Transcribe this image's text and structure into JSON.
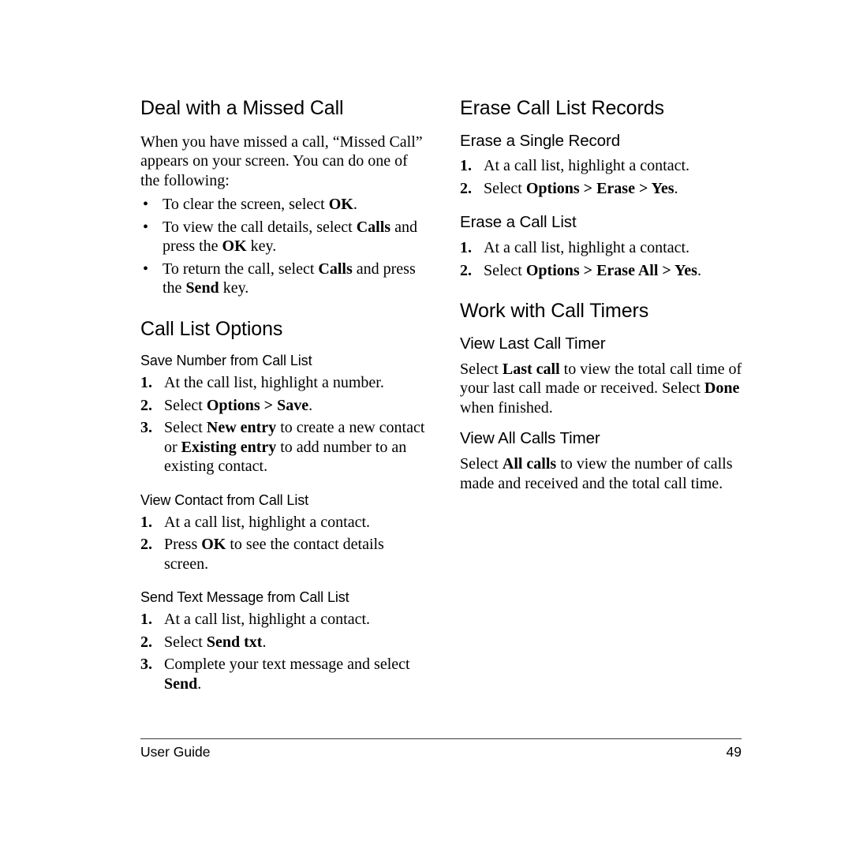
{
  "page": {
    "footer_label": "User Guide",
    "page_number": "49"
  },
  "left_column": {
    "section1": {
      "heading": "Deal with a Missed Call",
      "intro": "When you have missed a call, “Missed Call” appears on your screen. You can do one of the following:",
      "bullets": [
        {
          "marker": "•",
          "text_before": "To clear the screen, select ",
          "bold1": "OK",
          "text_after": "."
        },
        {
          "marker": "•",
          "text_before": "To view the call details, select ",
          "bold1": "Calls",
          "text_mid": " and press the ",
          "bold2": "OK",
          "text_after": " key."
        },
        {
          "marker": "•",
          "text_before": "To return the call, select ",
          "bold1": "Calls",
          "text_mid": " and press the ",
          "bold2": "Send",
          "text_after": " key."
        }
      ]
    },
    "section2": {
      "heading": "Call List Options",
      "sub1": {
        "heading": "Save Number from Call List",
        "steps": [
          {
            "marker": "1.",
            "text_before": "At the call list, highlight a number.",
            "bold1": "",
            "text_after": ""
          },
          {
            "marker": "2.",
            "text_before": "Select ",
            "bold1": "Options > Save",
            "text_after": "."
          },
          {
            "marker": "3.",
            "text_before": "Select ",
            "bold1": "New entry",
            "text_mid": " to create a new contact or ",
            "bold2": "Existing entry",
            "text_after": " to add number to an existing contact."
          }
        ]
      },
      "sub2": {
        "heading": "View Contact from Call List",
        "steps": [
          {
            "marker": "1.",
            "text_before": "At a call list, highlight a contact.",
            "bold1": "",
            "text_after": ""
          },
          {
            "marker": "2.",
            "text_before": "Press ",
            "bold1": "OK",
            "text_after": " to see the contact details screen."
          }
        ]
      },
      "sub3": {
        "heading": "Send Text Message from Call List",
        "steps": [
          {
            "marker": "1.",
            "text_before": "At a call list, highlight a contact.",
            "bold1": "",
            "text_after": ""
          },
          {
            "marker": "2.",
            "text_before": "Select ",
            "bold1": "Send txt",
            "text_after": "."
          },
          {
            "marker": "3.",
            "text_before": "Complete your text message and select ",
            "bold1": "Send",
            "text_after": "."
          }
        ]
      }
    }
  },
  "right_column": {
    "section1": {
      "heading": "Erase Call List Records",
      "sub1": {
        "heading": "Erase a Single Record",
        "steps": [
          {
            "marker": "1.",
            "text_before": "At a call list, highlight a contact.",
            "bold1": "",
            "text_after": ""
          },
          {
            "marker": "2.",
            "text_before": "Select ",
            "bold1": "Options > Erase > Yes",
            "text_after": "."
          }
        ]
      },
      "sub2": {
        "heading": "Erase a Call List",
        "steps": [
          {
            "marker": "1.",
            "text_before": "At a call list, highlight a contact.",
            "bold1": "",
            "text_after": ""
          },
          {
            "marker": "2.",
            "text_before": "Select ",
            "bold1": "Options > Erase All > Yes",
            "text_after": "."
          }
        ]
      }
    },
    "section2": {
      "heading": "Work with Call Timers",
      "sub1": {
        "heading": "View Last Call Timer",
        "para_before": "Select ",
        "bold1": "Last call",
        "para_mid": " to view the total call time of your last call made or received. Select ",
        "bold2": "Done",
        "para_after": " when finished."
      },
      "sub2": {
        "heading": "View All Calls Timer",
        "para_before": "Select ",
        "bold1": "All calls",
        "para_after": " to view the number of calls made and received and the total call time."
      }
    }
  }
}
